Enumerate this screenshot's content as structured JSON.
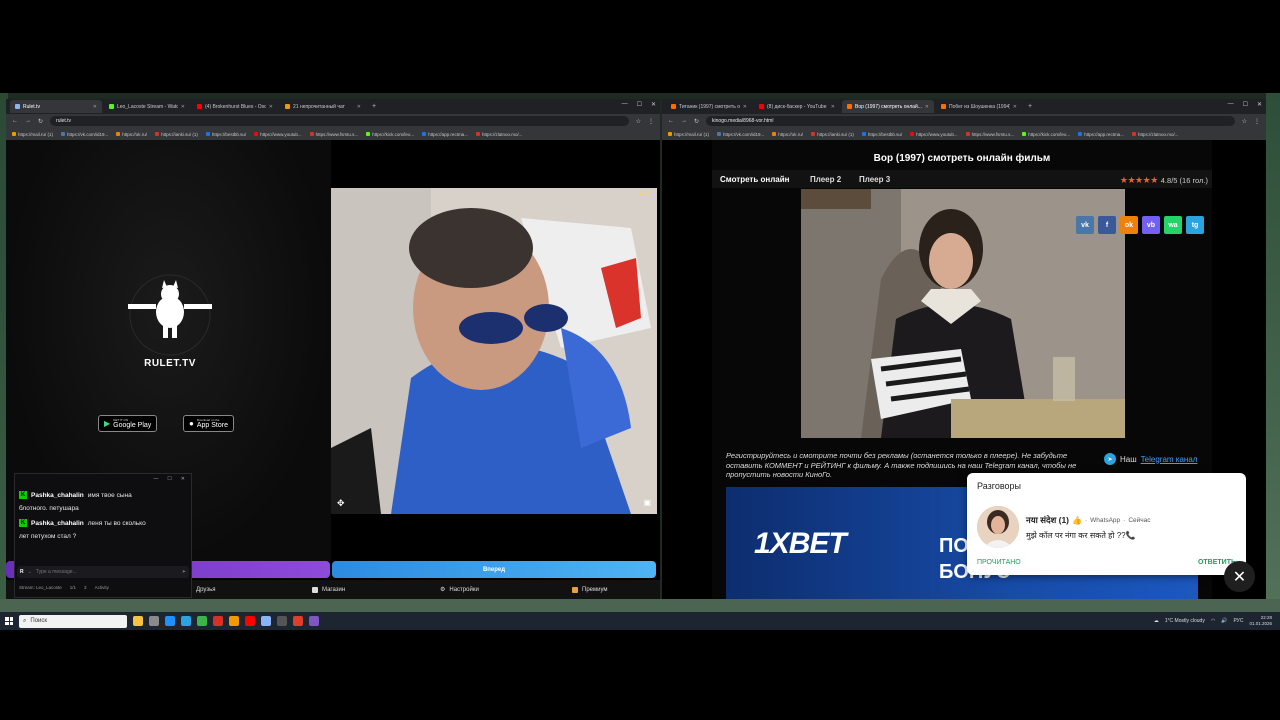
{
  "left_browser": {
    "tabs": [
      {
        "label": "Rulet.tv",
        "color": "#8ab4f8",
        "active": true
      },
      {
        "label": "Leo_Lacoste Stream - Watch Li...",
        "color": "#53fc18",
        "active": false
      },
      {
        "label": "(4) Brokenhurst Blues - Oscar ...",
        "color": "#ff0000",
        "active": false
      },
      {
        "label": "21 непрочитанный чат",
        "color": "#f29900",
        "active": false
      }
    ],
    "url": "rulet.tv",
    "bookmarks": [
      "https://mail.ru/ (1)",
      "https://vk.com/id19...",
      "https://ok.ru/",
      "https://ianki.su/ (1)",
      "https://bestbb.su/",
      "https://www.youtub...",
      "https://www.fsmtu.s...",
      "https://kick.com/leo...",
      "https://app.rectma...",
      "https://zlatnoo.mo/..."
    ]
  },
  "rulet": {
    "logo": "RULET.TV",
    "google_play": {
      "small": "GET IT ON",
      "big": "Google Play"
    },
    "app_store": {
      "small": "Download on the",
      "big": "App Store"
    },
    "viewer_count": "25",
    "start_button": "Вперед",
    "nav": [
      "Друзья",
      "Магазин",
      "Настройки",
      "Премиум"
    ]
  },
  "chat": {
    "messages": [
      {
        "user": "Pashka_chahalin",
        "text": "имя твое сына"
      },
      {
        "user": "",
        "text": "блотного. петушара"
      },
      {
        "user": "Pashka_chahalin",
        "text": "леня ты во сколько"
      },
      {
        "user": "",
        "text": "лет петухом стал ?"
      }
    ],
    "input_placeholder": "Type a message...",
    "footer": [
      "Stream: Leo_Lacoste",
      "1/1",
      "3",
      "Activity"
    ]
  },
  "right_browser": {
    "tabs": [
      {
        "label": "Титаник (1997) смотреть онлай...",
        "color": "#ff6f00",
        "active": false
      },
      {
        "label": "(8) диск-баскер - YouTube",
        "color": "#ff0000",
        "active": false
      },
      {
        "label": "Вор (1997) смотреть онлай...",
        "color": "#ff6f00",
        "active": true
      },
      {
        "label": "Побег из Шоушенка (1994) см...",
        "color": "#ff6f00",
        "active": false
      }
    ],
    "url": "kinogo.media/8968-vor.html",
    "bookmarks": [
      "https://mail.ru/ (1)",
      "https://vk.com/id19...",
      "https://ok.ru/",
      "https://ianki.su/ (1)",
      "https://bestbb.su/",
      "https://www.youtub...",
      "https://www.fsmtu.s...",
      "https://kick.com/leo...",
      "https://app.rectma...",
      "https://zlatnoo.mo/..."
    ]
  },
  "movie": {
    "title": "Вор (1997) смотреть онлайн фильм",
    "tabs": [
      "Смотреть онлайн",
      "Плеер 2",
      "Плеер 3"
    ],
    "stars": "★★★★★",
    "rating": "4.8/5 (16 гол.)",
    "social": [
      {
        "label": "vk",
        "color": "#4a76a8"
      },
      {
        "label": "f",
        "color": "#3b5998"
      },
      {
        "label": "ok",
        "color": "#ee8208"
      },
      {
        "label": "vb",
        "color": "#7360f2"
      },
      {
        "label": "wa",
        "color": "#25d366"
      },
      {
        "label": "tg",
        "color": "#2aa3df"
      }
    ],
    "notice": "Регистрируйтесь и смотрите почти без рекламы (останется только в плеере). Не забудьте оставить КОММЕНТ и РЕЙТИНГ к фильму. А также подпишись на наш Telegram канал, чтобы не пропустить новости КиноГо.",
    "tg_prefix": "Наш",
    "tg_link": "Telegram канал",
    "banner_logo": "1XBET",
    "banner_text1": "ПО",
    "banner_text2": "БОНУС"
  },
  "notification": {
    "title": "Разговоры",
    "sender": "नया संदेश (1)",
    "app": "WhatsApp",
    "time": "Сейчас",
    "body": "मुझे कॉल पर नंगा कर सकते हो ??📞",
    "read": "ПРОЧИТАНО",
    "reply": "ОТВЕТИТЬ"
  },
  "taskbar": {
    "search": "Поиск",
    "weather": "1°C  Mostly cloudy",
    "lang": "РУС",
    "time": "22:28",
    "date": "01.01.2026"
  }
}
